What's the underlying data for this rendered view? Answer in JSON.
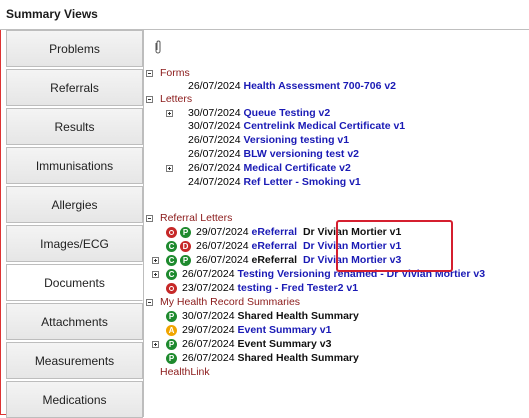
{
  "window": {
    "title": "Summary Views"
  },
  "sidebar": {
    "items": [
      {
        "label": "Problems"
      },
      {
        "label": "Referrals"
      },
      {
        "label": "Results"
      },
      {
        "label": "Immunisations"
      },
      {
        "label": "Allergies"
      },
      {
        "label": "Images/ECG"
      },
      {
        "label": "Documents",
        "active": true
      },
      {
        "label": "Attachments"
      },
      {
        "label": "Measurements"
      },
      {
        "label": "Medications"
      }
    ]
  },
  "content": {
    "attachment_icon": "paperclip-icon",
    "groups": {
      "forms": {
        "label": "Forms",
        "items": [
          {
            "date": "26/07/2024",
            "title": "Health Assessment 700-706 v2"
          }
        ]
      },
      "letters": {
        "label": "Letters",
        "items": [
          {
            "date": "30/07/2024",
            "title": "Queue Testing v2"
          },
          {
            "date": "30/07/2024",
            "title": "Centrelink Medical Certificate v1"
          },
          {
            "date": "26/07/2024",
            "title": "Versioning testing v1"
          },
          {
            "date": "26/07/2024",
            "title": "BLW versioning test v2"
          },
          {
            "date": "26/07/2024",
            "title": "Medical Certificate v2"
          },
          {
            "date": "24/07/2024",
            "title": "Ref Letter - Smoking v1"
          }
        ]
      },
      "referral_letters": {
        "label": "Referral Letters",
        "items": [
          {
            "date": "29/07/2024",
            "title": "eReferral",
            "doctor": "Dr Vivian Mortier v1",
            "icons": [
              "O",
              "P"
            ]
          },
          {
            "date": "26/07/2024",
            "title": "eReferral",
            "doctor": "Dr Vivian Mortier v1",
            "icons": [
              "C",
              "D"
            ]
          },
          {
            "date": "26/07/2024",
            "title": "eReferral",
            "doctor": "Dr Vivian Mortier v3",
            "icons": [
              "C",
              "P"
            ]
          },
          {
            "date": "26/07/2024",
            "title": "Testing Versioning renamed - Dr Vivian Mortier v3",
            "icons": [
              "C"
            ]
          },
          {
            "date": "23/07/2024",
            "title": "testing - Fred Tester2 v1",
            "icons": [
              "O"
            ]
          }
        ]
      },
      "my_health_record": {
        "label": "My Health Record Summaries",
        "items": [
          {
            "date": "30/07/2024",
            "title": "Shared Health Summary",
            "icons": [
              "P"
            ]
          },
          {
            "date": "29/07/2024",
            "title": "Event Summary v1",
            "icons": [
              "A"
            ]
          },
          {
            "date": "26/07/2024",
            "title": "Event Summary v3",
            "icons": [
              "P"
            ]
          },
          {
            "date": "26/07/2024",
            "title": "Shared Health Summary",
            "icons": [
              "P"
            ]
          }
        ]
      },
      "healthlink": {
        "label": "HealthLink"
      }
    }
  },
  "colors": {
    "group_label": "#8b1a1a",
    "link_title": "#1a1ab5",
    "highlight_border": "#d51f2f",
    "icon_green": "#1e8a2e",
    "icon_red": "#c62828",
    "icon_orange": "#f0a500"
  }
}
